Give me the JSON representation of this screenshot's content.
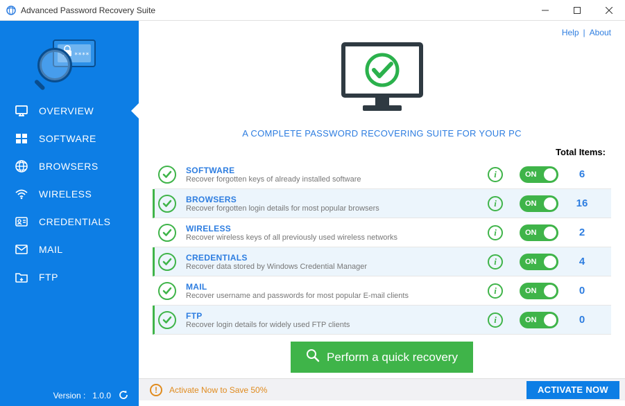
{
  "window": {
    "title": "Advanced Password Recovery Suite"
  },
  "header": {
    "help": "Help",
    "about": "About"
  },
  "hero": {
    "tagline": "A COMPLETE PASSWORD RECOVERING SUITE FOR YOUR PC"
  },
  "sidebar": {
    "items": [
      {
        "label": "OVERVIEW",
        "icon": "monitor-icon",
        "active": true
      },
      {
        "label": "SOFTWARE",
        "icon": "windows-icon",
        "active": false
      },
      {
        "label": "BROWSERS",
        "icon": "globe-icon",
        "active": false
      },
      {
        "label": "WIRELESS",
        "icon": "wifi-icon",
        "active": false
      },
      {
        "label": "CREDENTIALS",
        "icon": "id-icon",
        "active": false
      },
      {
        "label": "MAIL",
        "icon": "mail-icon",
        "active": false
      },
      {
        "label": "FTP",
        "icon": "folder-icon",
        "active": false
      }
    ]
  },
  "version": {
    "label": "Version :",
    "value": "1.0.0"
  },
  "total_items_label": "Total Items:",
  "categories": [
    {
      "title": "SOFTWARE",
      "desc": "Recover forgotten keys of already installed software",
      "on_label": "ON",
      "count": 6,
      "selected": false
    },
    {
      "title": "BROWSERS",
      "desc": "Recover forgotten login details for most popular browsers",
      "on_label": "ON",
      "count": 16,
      "selected": true
    },
    {
      "title": "WIRELESS",
      "desc": "Recover wireless keys of all previously used wireless networks",
      "on_label": "ON",
      "count": 2,
      "selected": false
    },
    {
      "title": "CREDENTIALS",
      "desc": "Recover data stored by Windows Credential Manager",
      "on_label": "ON",
      "count": 4,
      "selected": true
    },
    {
      "title": "MAIL",
      "desc": "Recover username and passwords for most popular E-mail clients",
      "on_label": "ON",
      "count": 0,
      "selected": false
    },
    {
      "title": "FTP",
      "desc": "Recover login details for widely used FTP clients",
      "on_label": "ON",
      "count": 0,
      "selected": true
    }
  ],
  "recover_button": "Perform a quick recovery",
  "footer": {
    "promo": "Activate Now to Save 50%",
    "activate": "ACTIVATE NOW"
  }
}
